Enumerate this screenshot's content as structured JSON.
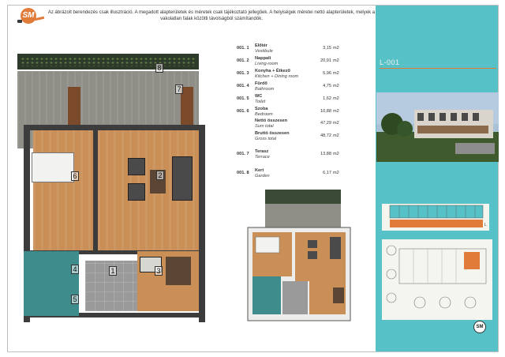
{
  "disclaimer": "Az ábrázolt berendezés csak illusztráció. A megadott alapterületek és méretek csak tájékoztató jellegűek. A helyiségek méretei nettó alapterületek, melyek a vakolatlan falak közötti távolságból számítandók.",
  "unit_code": "L-001",
  "logo_text": "SM",
  "rooms": [
    {
      "code": "001. 1",
      "name": "Előtér",
      "sub": "Vestibule",
      "value": "3,15",
      "unit": "m2"
    },
    {
      "code": "001. 2",
      "name": "Nappali",
      "sub": "Living-room",
      "value": "20,91",
      "unit": "m2"
    },
    {
      "code": "001. 3",
      "name": "Konyha + Étkező",
      "sub": "Kitchen + Dining room",
      "value": "5,96",
      "unit": "m2"
    },
    {
      "code": "001. 4",
      "name": "Fürdő",
      "sub": "Bathroom",
      "value": "4,75",
      "unit": "m2"
    },
    {
      "code": "001. 5",
      "name": "WC",
      "sub": "Toilet",
      "value": "1,62",
      "unit": "m2"
    },
    {
      "code": "001. 6",
      "name": "Szoba",
      "sub": "Bedroom",
      "value": "10,88",
      "unit": "m2"
    },
    {
      "code": "",
      "name": "Nettó összesen",
      "sub": "Sum total",
      "value": "47,29",
      "unit": "m2"
    },
    {
      "code": "",
      "name": "Bruttó összesen",
      "sub": "Gross total",
      "value": "48,72",
      "unit": "m2"
    },
    {
      "code": "001. 7",
      "name": "Terasz",
      "sub": "Terrace",
      "value": "13,88",
      "unit": "m2"
    },
    {
      "code": "001. 8",
      "name": "Kert",
      "sub": "Garden",
      "value": "6,17",
      "unit": "m2"
    }
  ],
  "room_numbers": [
    "8",
    "7",
    "6",
    "2",
    "1",
    "3",
    "4",
    "5"
  ],
  "minimap_marker": "L",
  "colors": {
    "accent": "#e07b39",
    "panel": "#56c2c7",
    "floor_wood": "#c98f57",
    "wet_rooms": "#3e8c8c",
    "walls": "#3c3c3c"
  }
}
